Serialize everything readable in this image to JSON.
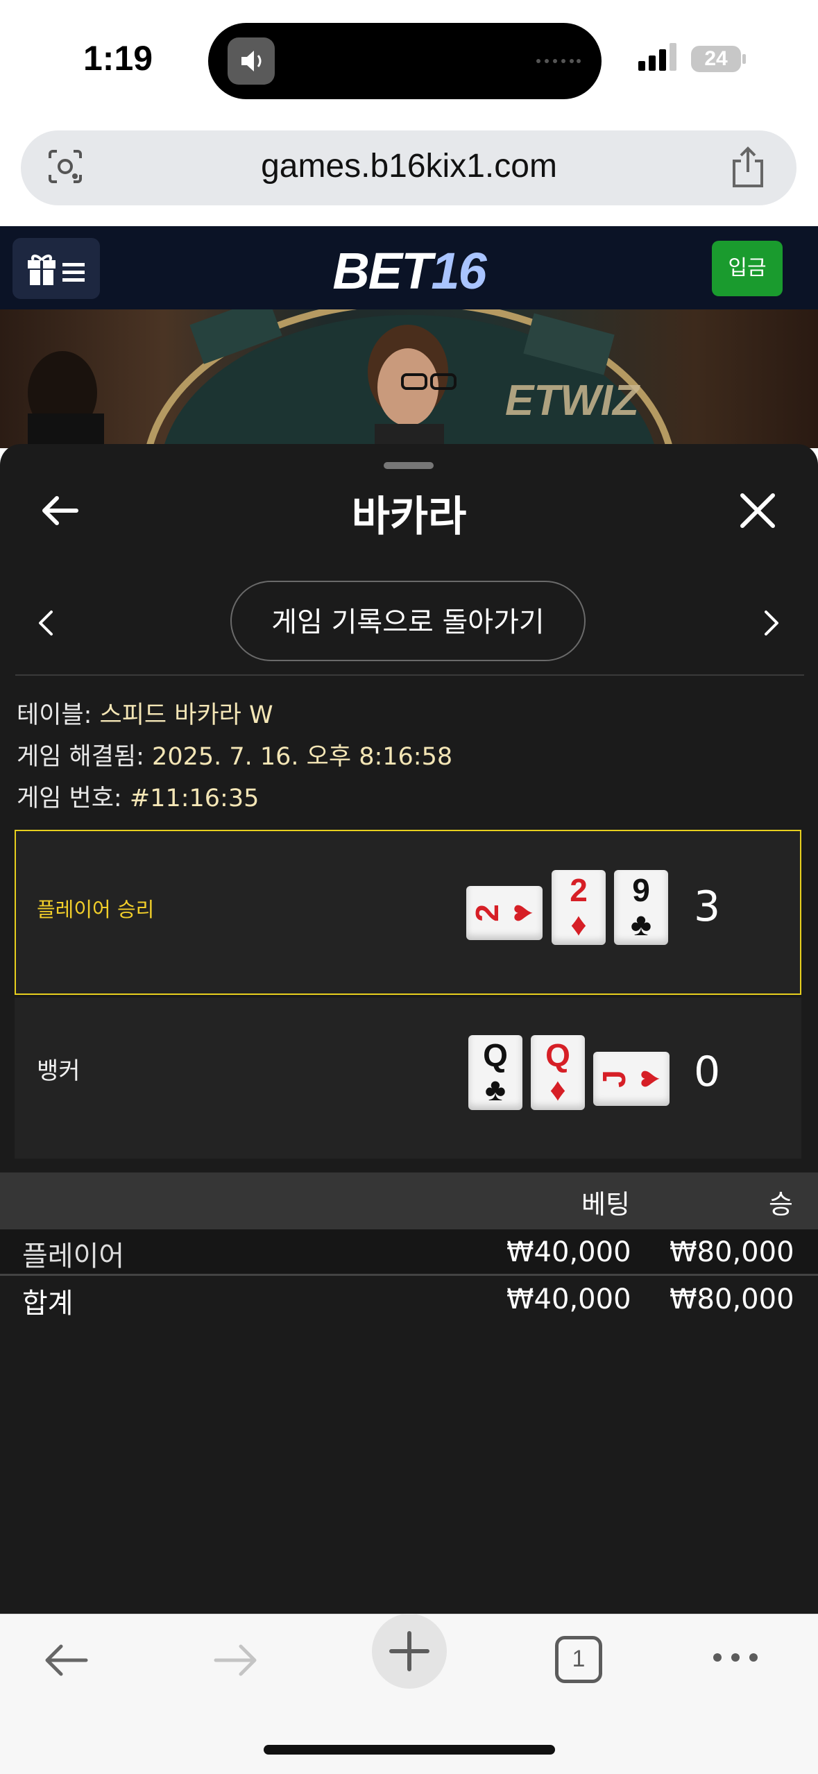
{
  "status_bar": {
    "time": "1:19",
    "battery": "24"
  },
  "browser": {
    "url": "games.b16kix1.com",
    "tab_count": "1"
  },
  "site": {
    "logo_main": "BET",
    "logo_accent": "16",
    "deposit_label": "입금"
  },
  "video": {
    "overlay_text": "ETWIZ"
  },
  "panel": {
    "title": "바카라",
    "back_to_history": "게임 기록으로 돌아가기",
    "info": {
      "table_label": "테이블: ",
      "table_value": "스피드 바카라 W",
      "resolved_label": "게임 해결됨: ",
      "resolved_value": "2025. 7. 16. 오후 8:16:58",
      "number_label": "게임 번호: ",
      "number_value": "#11:16:35"
    },
    "player": {
      "label": "플레이어 승리",
      "score": "3",
      "cards": [
        {
          "rank": "2",
          "suit": "♥",
          "color": "#d61f26",
          "rotated": true
        },
        {
          "rank": "2",
          "suit": "♦",
          "color": "#d61f26",
          "rotated": false
        },
        {
          "rank": "9",
          "suit": "♣",
          "color": "#111111",
          "rotated": false
        }
      ]
    },
    "banker": {
      "label": "뱅커",
      "score": "0",
      "cards": [
        {
          "rank": "Q",
          "suit": "♣",
          "color": "#111111",
          "rotated": false
        },
        {
          "rank": "Q",
          "suit": "♦",
          "color": "#d61f26",
          "rotated": false
        },
        {
          "rank": "J",
          "suit": "♥",
          "color": "#d61f26",
          "rotated": true
        }
      ]
    },
    "bets": {
      "col_bet": "베팅",
      "col_win": "승",
      "row_label": "플레이어",
      "row_bet": "₩40,000",
      "row_win": "₩80,000",
      "total_label": "합계",
      "total_bet": "₩40,000",
      "total_win": "₩80,000"
    }
  },
  "colors": {
    "highlight_border": "#e7cf1e",
    "deposit_green": "#1a9b2e",
    "card_red": "#d61f26"
  }
}
